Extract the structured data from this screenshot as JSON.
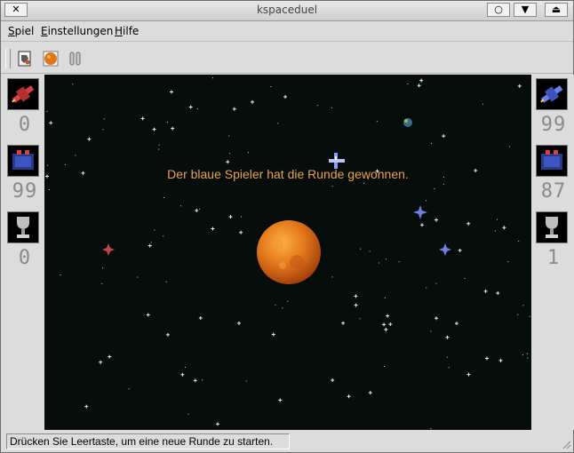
{
  "window": {
    "title": "kspaceduel",
    "close_glyph": "✕",
    "minimize_glyph": "○",
    "maximize_glyph": "▼",
    "shade_glyph": "⏏"
  },
  "menu": [
    {
      "label": "Spiel",
      "mnemonic": "S"
    },
    {
      "label": "Einstellungen",
      "mnemonic": "E"
    },
    {
      "label": "Hilfe",
      "mnemonic": "H"
    }
  ],
  "toolbar": {
    "icons": [
      "new-round-icon",
      "new-game-icon",
      "pause-icon"
    ]
  },
  "left_panel": {
    "hit_points": "0",
    "energy": "99",
    "wins": "0"
  },
  "right_panel": {
    "hit_points": "99",
    "energy": "87",
    "wins": "1"
  },
  "arena": {
    "message": "Der blaue Spieler hat die Runde gewonnen.",
    "message_color": "#e8a24a",
    "background": "#060d0b"
  },
  "statusbar": {
    "text": "Drücken Sie Leertaste, um eine neue Runde zu starten."
  }
}
